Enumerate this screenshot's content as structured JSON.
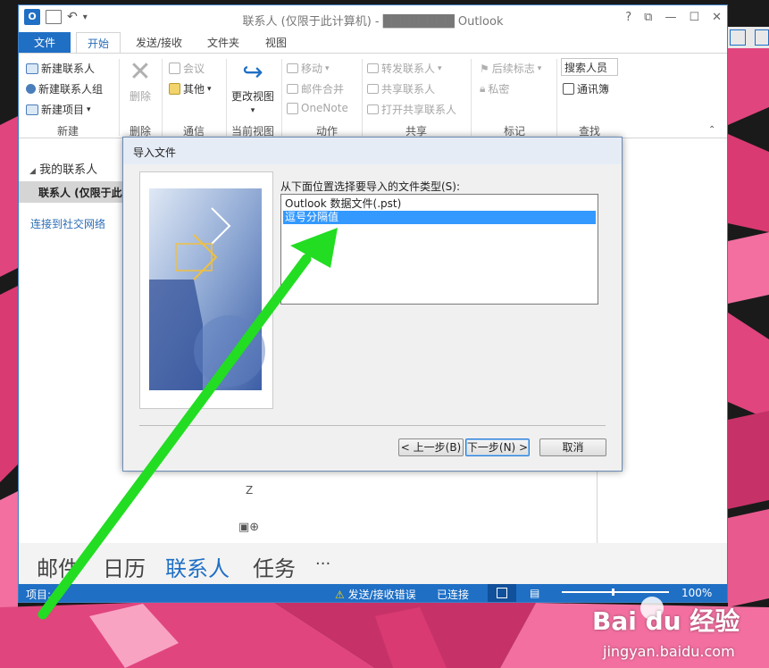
{
  "window": {
    "title": "联系人 (仅限于此计算机) - ████████ Outlook",
    "qat_label": "▾",
    "controls": [
      "?",
      "⧉",
      "—",
      "☐",
      "✕"
    ]
  },
  "tabs": [
    {
      "label": "文件",
      "type": "file"
    },
    {
      "label": "开始",
      "type": "active"
    },
    {
      "label": "发送/接收"
    },
    {
      "label": "文件夹"
    },
    {
      "label": "视图"
    }
  ],
  "ribbon": {
    "new_contact": "新建联系人",
    "new_group": "新建联系人组",
    "new_items": "新建项目",
    "delete": "删除",
    "meeting": "会议",
    "more": "其他",
    "change_view": "更改视图",
    "move": "移动",
    "mail_merge": "邮件合并",
    "onenote": "OneNote",
    "forward_contact": "转发联系人",
    "share_contacts": "共享联系人",
    "open_shared": "打开共享联系人",
    "follow_up": "后续标志",
    "private": "私密",
    "search_people": "搜索人员",
    "address_book": "通讯簿",
    "groups": {
      "new": "新建",
      "delete": "删除",
      "communicate": "通信",
      "current_view": "当前视图",
      "actions": "动作",
      "share": "共享",
      "tags": "标记",
      "find": "查找"
    }
  },
  "nav": {
    "header": "我的联系人",
    "selected": "联系人 (仅限于此",
    "social_link": "连接到社交网络"
  },
  "content": {
    "letter": "Z"
  },
  "bottom_nav": [
    "邮件",
    "日历",
    "联系人",
    "任务",
    "···"
  ],
  "status": {
    "items": "项目: 0",
    "send_error": "发送/接收错误",
    "connected": "已连接",
    "zoom": "100%"
  },
  "dialog": {
    "title": "导入文件",
    "prompt": "从下面位置选择要导入的文件类型(S):",
    "options": [
      {
        "label": "Outlook 数据文件(.pst)",
        "selected": false
      },
      {
        "label": "逗号分隔值",
        "selected": true
      }
    ],
    "back": "< 上一步(B)",
    "next": "下一步(N) >",
    "cancel": "取消"
  },
  "watermark": {
    "brand": "Bai du 经验",
    "url": "jingyan.baidu.com"
  },
  "colors": {
    "accent": "#1f6fc5",
    "selection": "#3399ff",
    "arrow": "#22dd22",
    "background": "#e0457e"
  }
}
